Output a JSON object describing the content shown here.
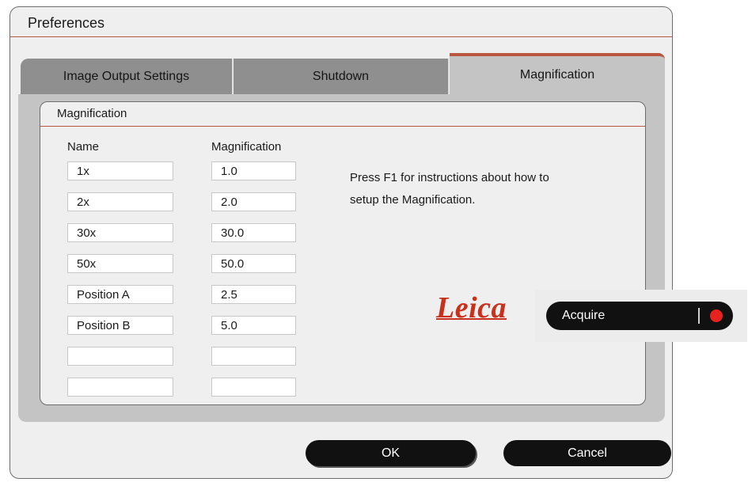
{
  "window": {
    "title": "Preferences"
  },
  "tabs": [
    {
      "label": "Image Output Settings",
      "active": false
    },
    {
      "label": "Shutdown",
      "active": false
    },
    {
      "label": "Magnification",
      "active": true
    }
  ],
  "group": {
    "title": "Magnification",
    "col_name": "Name",
    "col_mag": "Magnification",
    "rows": [
      {
        "name": "1x",
        "magnification": "1.0"
      },
      {
        "name": "2x",
        "magnification": "2.0"
      },
      {
        "name": "30x",
        "magnification": "30.0"
      },
      {
        "name": "50x",
        "magnification": "50.0"
      },
      {
        "name": "Position A",
        "magnification": "2.5"
      },
      {
        "name": "Position B",
        "magnification": "5.0"
      },
      {
        "name": "",
        "magnification": ""
      },
      {
        "name": "",
        "magnification": ""
      }
    ]
  },
  "hint": {
    "line1": "Press F1 for instructions about how to",
    "line2": "setup the Magnification."
  },
  "brand": {
    "logo": "Leica",
    "color": "#c8321c"
  },
  "acquire": {
    "label": "Acquire",
    "indicator_color": "#e8231f"
  },
  "buttons": {
    "ok": "OK",
    "cancel": "Cancel"
  },
  "colors": {
    "accent": "#b85640"
  }
}
